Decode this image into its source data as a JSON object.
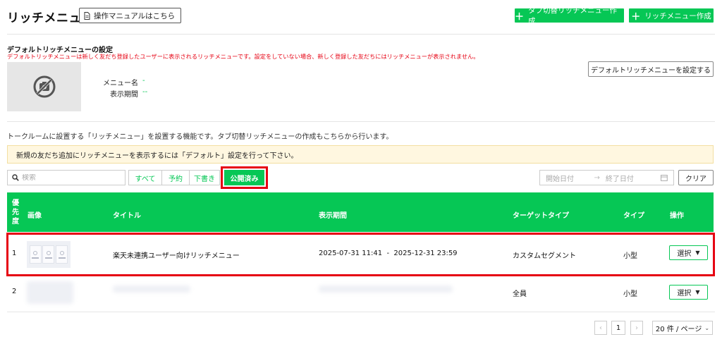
{
  "header": {
    "title": "リッチメニュー",
    "manual_label": "操作マニュアルはこちら",
    "create_tab_label": "タブ切替リッチメニュー作成",
    "create_label": "リッチメニュー作成"
  },
  "default_settings": {
    "title": "デフォルトリッチメニューの設定",
    "note": "デフォルトリッチメニューは新しく友だち登録したユーザーに表示されるリッチメニューです。設定をしていない場合、新しく登録した友だちにはリッチメニューが表示されません。",
    "menu_name_label": "メニュー名",
    "menu_name_value": "-",
    "period_label": "表示期間",
    "period_value": "--",
    "set_button_label": "デフォルトリッチメニューを設定する"
  },
  "description": "トークルームに設置する「リッチメニュー」を設置する機能です。タブ切替リッチメニューの作成もこちらから行います。",
  "notice": "新規の友だち追加にリッチメニューを表示するには「デフォルト」設定を行って下さい。",
  "filters": {
    "search_placeholder": "検索",
    "tabs": [
      "すべて",
      "予約",
      "下書き",
      "公開済み"
    ],
    "start_date_placeholder": "開始日付",
    "end_date_placeholder": "終了日付",
    "clear_label": "クリア"
  },
  "table": {
    "headers": {
      "priority": "優先度",
      "image": "画像",
      "title": "タイトル",
      "period": "表示期間",
      "target": "ターゲットタイプ",
      "type": "タイプ",
      "action": "操作"
    },
    "rows": [
      {
        "priority": "1",
        "title": "楽天未連携ユーザー向けリッチメニュー",
        "period": "2025-07-31 11:41  -  2025-12-31 23:59",
        "target": "カスタムセグメント",
        "type": "小型",
        "action": "選択"
      },
      {
        "priority": "2",
        "title": "",
        "period": "",
        "target": "全員",
        "type": "小型",
        "action": "選択"
      }
    ]
  },
  "pagination": {
    "current_page": "1",
    "per_page": "20 件 / ページ"
  },
  "colors": {
    "brand_green": "#06c755",
    "highlight_red": "#e60012",
    "notice_bg": "#fff7e0"
  }
}
